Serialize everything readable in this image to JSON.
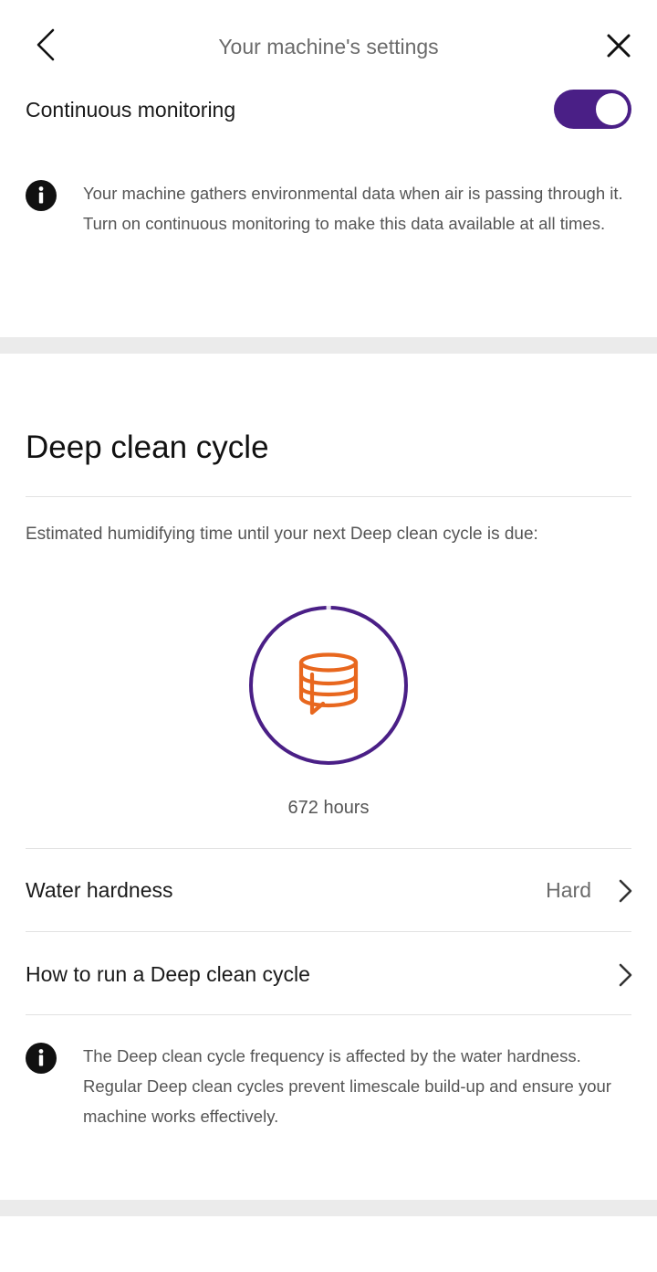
{
  "header": {
    "title": "Your machine's settings"
  },
  "monitoring": {
    "label": "Continuous monitoring",
    "enabled": true,
    "info": "Your machine gathers environmental data when air is passing through it. Turn on continuous monitoring to make this data available at all times."
  },
  "deep_clean": {
    "title": "Deep clean cycle",
    "subtitle": "Estimated humidifying time until your next Deep clean cycle is due:",
    "hours_label": "672 hours",
    "progress_fraction": 0.99,
    "ring_color": "#4a1f86",
    "icon_color": "#e8671e",
    "icon": "humidifier-tank-icon"
  },
  "water_hardness": {
    "label": "Water hardness",
    "value": "Hard"
  },
  "how_to": {
    "label": "How to run a Deep clean cycle"
  },
  "footer_info": {
    "text": "The Deep clean cycle frequency is affected by the water hardness. Regular Deep clean cycles prevent limescale build-up and ensure your machine works effectively."
  },
  "colors": {
    "accent": "#4a1f86",
    "band": "#ebebeb"
  }
}
